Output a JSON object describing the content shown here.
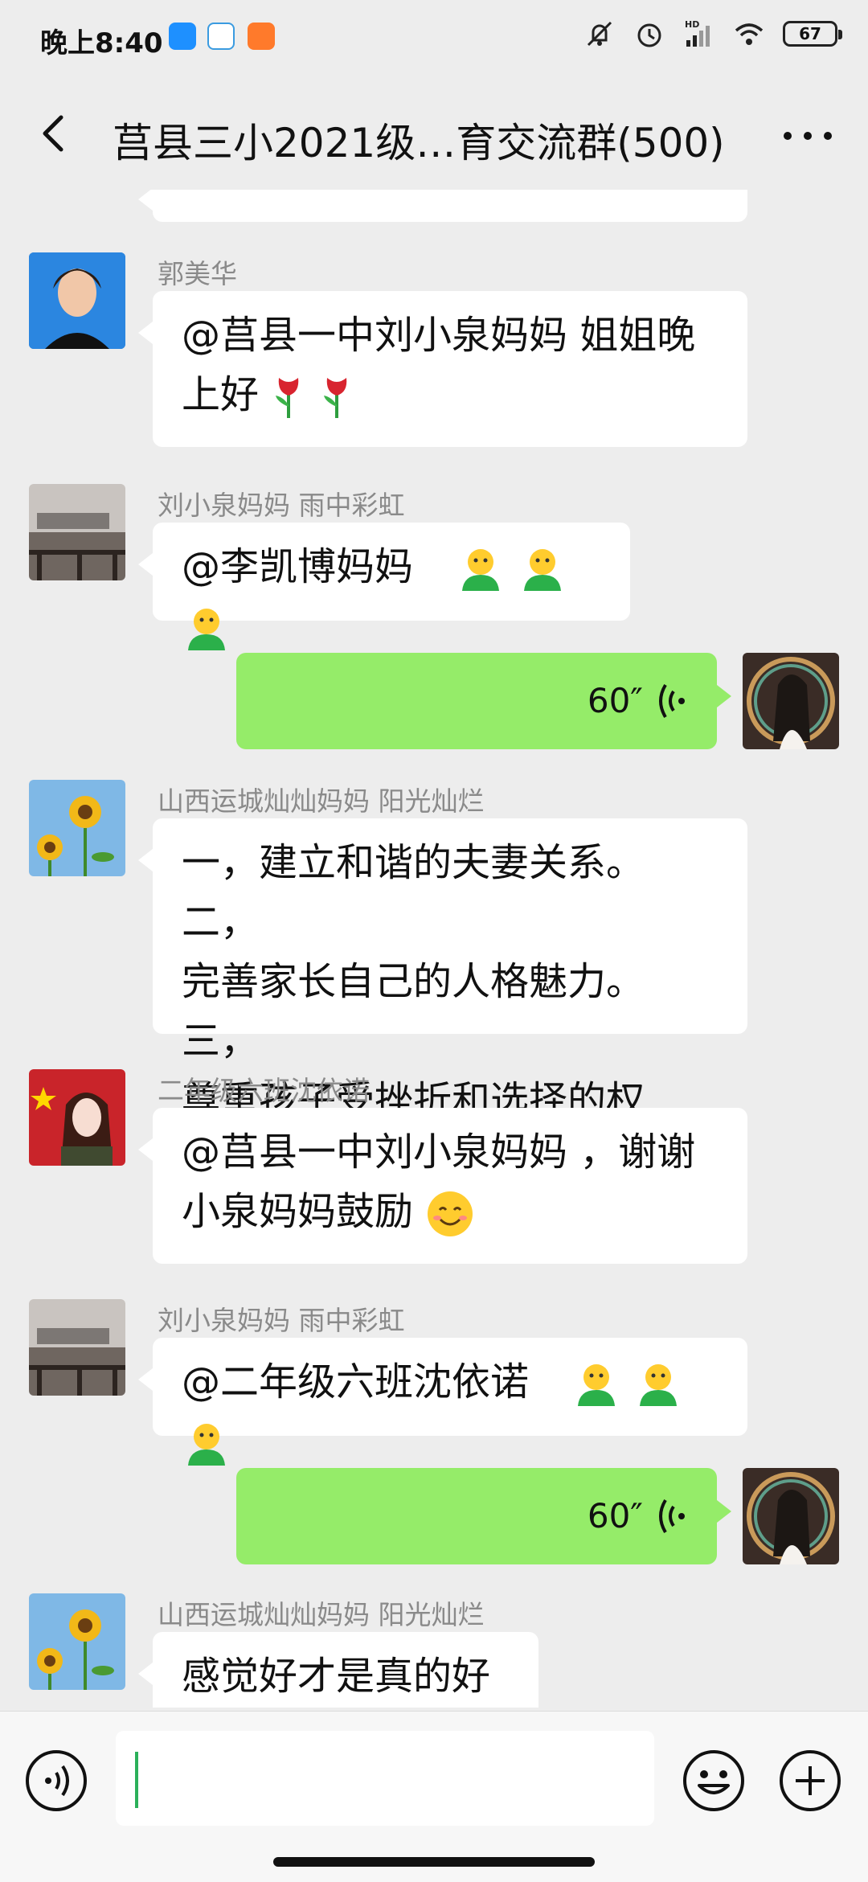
{
  "status": {
    "time": "晚上8:40",
    "battery": "67",
    "hd": "HD"
  },
  "header": {
    "title": "莒县三小2021级…育交流群(500)"
  },
  "messages": [
    {
      "sender": "郭美华",
      "text": "@莒县一中刘小泉妈妈  姐姐晚上好🌹🌹",
      "line1": "@莒县一中刘小泉妈妈  姐姐晚",
      "line2": "上好"
    },
    {
      "sender": "刘小泉妈妈  雨中彩虹",
      "text": "@李凯博妈妈"
    },
    {
      "duration": "60″"
    },
    {
      "sender": "山西运城灿灿妈妈  阳光灿烂",
      "line1": "一，建立和谐的夫妻关系。二，",
      "line2": "完善家长自己的人格魅力。三，",
      "line3": "尊重孩子受挫折和选择的权利。"
    },
    {
      "sender": "二年级六班沈依诺",
      "line1": "@莒县一中刘小泉妈妈 ，谢谢",
      "line2": "小泉妈妈鼓励"
    },
    {
      "sender": "刘小泉妈妈  雨中彩虹",
      "text": "@二年级六班沈依诺"
    },
    {
      "duration": "60″"
    },
    {
      "sender": "山西运城灿灿妈妈  阳光灿烂",
      "text": "感觉好才是真的好"
    }
  ],
  "colors": {
    "background": "#ededed",
    "outgoing_bubble": "#95ec69",
    "incoming_bubble": "#ffffff",
    "caret": "#2bb05a"
  },
  "icons": [
    "back-arrow-icon",
    "more-icon",
    "voice-wave-icon",
    "voice-input-icon",
    "emoji-icon",
    "plus-icon"
  ]
}
